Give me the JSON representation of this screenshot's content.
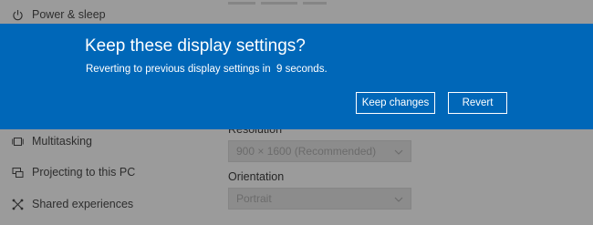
{
  "sidebar": {
    "items": [
      {
        "label": "Power & sleep",
        "icon": "power-icon"
      },
      {
        "label": "Multitasking",
        "icon": "multitasking-icon"
      },
      {
        "label": "Projecting to this PC",
        "icon": "projecting-icon"
      },
      {
        "label": "Shared experiences",
        "icon": "shared-experiences-icon"
      }
    ]
  },
  "main": {
    "resolution_label": "Resolution",
    "resolution_value": "900 × 1600 (Recommended)",
    "orientation_label": "Orientation",
    "orientation_value": "Portrait"
  },
  "dialog": {
    "title": "Keep these display settings?",
    "message": "Reverting to previous display settings in  9 seconds.",
    "keep_label": "Keep changes",
    "revert_label": "Revert",
    "background": "#0067b8"
  }
}
